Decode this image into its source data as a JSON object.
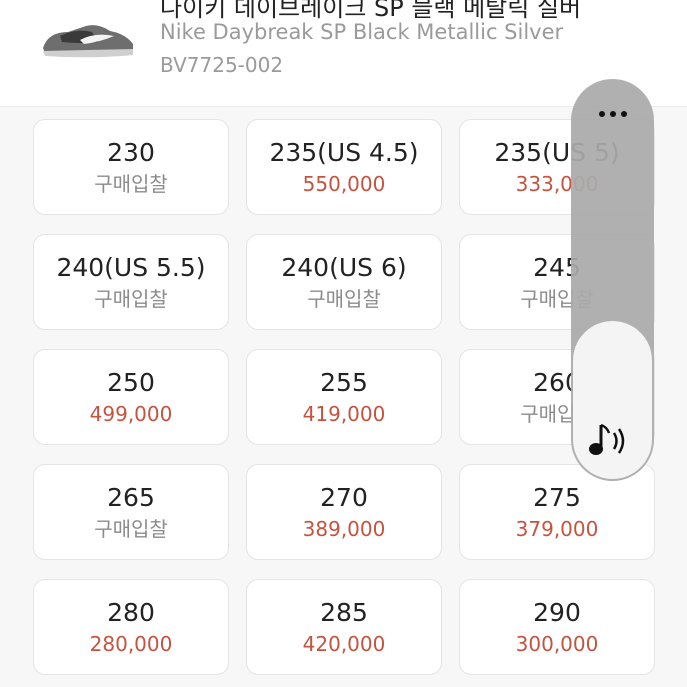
{
  "product": {
    "title_partial": "나이키 데이브레이크 SP 블랙 메탈릭 실버",
    "english_name": "Nike Daybreak SP Black Metallic Silver",
    "model_number": "BV7725-002"
  },
  "sizes": [
    {
      "size": "230",
      "price": "구매입찰",
      "has_price": false
    },
    {
      "size": "235(US 4.5)",
      "price": "550,000",
      "has_price": true
    },
    {
      "size": "235(US 5)",
      "price": "333,000",
      "has_price": true
    },
    {
      "size": "240(US 5.5)",
      "price": "구매입찰",
      "has_price": false
    },
    {
      "size": "240(US 6)",
      "price": "구매입찰",
      "has_price": false
    },
    {
      "size": "245",
      "price": "구매입찰",
      "has_price": false
    },
    {
      "size": "250",
      "price": "499,000",
      "has_price": true
    },
    {
      "size": "255",
      "price": "419,000",
      "has_price": true
    },
    {
      "size": "260",
      "price": "구매입찰",
      "has_price": false
    },
    {
      "size": "265",
      "price": "구매입찰",
      "has_price": false
    },
    {
      "size": "270",
      "price": "389,000",
      "has_price": true
    },
    {
      "size": "275",
      "price": "379,000",
      "has_price": true
    },
    {
      "size": "280",
      "price": "280,000",
      "has_price": true
    },
    {
      "size": "285",
      "price": "420,000",
      "has_price": true
    },
    {
      "size": "290",
      "price": "300,000",
      "has_price": true
    }
  ],
  "colors": {
    "price_accent": "#c4543f",
    "muted_text": "#8c8c8c"
  },
  "icons": {
    "more": "more-horizontal-icon",
    "audio": "audio-speaker-icon"
  }
}
